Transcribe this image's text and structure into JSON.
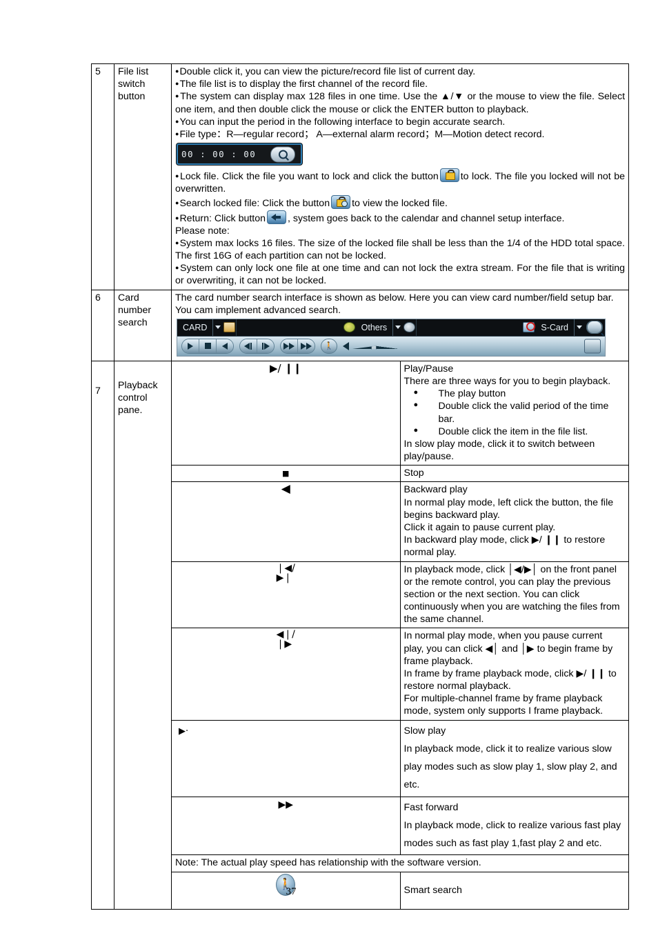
{
  "page": {
    "number": "37"
  },
  "table": {
    "rows": [
      {
        "num": "5",
        "name": "File list switch button",
        "bullets": [
          "Double click it, you can view the picture/record file list of current day.",
          "The file list is to display the first channel of the record file.",
          "The system can display max 128 files in one time. Use the ▲/▼ or the mouse to view the file. Select one item, and then double click the mouse or click the ENTER button to playback.",
          "You can input the period in the following interface to begin accurate search.",
          "File type：R—regular record；  A—external alarm record；M—Motion detect record."
        ],
        "time_widget": {
          "value": "00 : 00 : 00",
          "search_icon": "magnifier-icon"
        },
        "bullets2_a": "Lock file. Click the file you want to lock and click the button",
        "bullets2_a_tail": "to lock. The file you locked will not be overwritten.",
        "bullets2_b": "Search locked file: Click the button",
        "bullets2_b_tail": "to view the locked file.",
        "bullets2_c": "Return: Click button",
        "bullets2_c_tail": ", system goes back to the calendar and channel setup interface.",
        "please_note": "Please note:",
        "bullets3": [
          "System max locks 16 files. The size of the locked file shall be less than the 1/4 of the HDD total space. The first 16G of each partition can not be locked.",
          "System can only lock one file at one time and can not lock the extra stream. For the file that is writing or overwriting, it can not be locked."
        ]
      },
      {
        "num": "6",
        "name": "Card number search",
        "intro": "The card number search interface is shown as below. Here you can view card number/field setup bar. You cam implement advanced search.",
        "card_bar": {
          "field1_label": "CARD",
          "field1_icon": "card-icon",
          "field2_label": "Others",
          "field2_icon": "money-icon",
          "field3_icon": "coin-icon",
          "field4_icon": "scard-blocked-icon",
          "field4_label": "S-Card",
          "search_icon": "magnifier-icon"
        },
        "playbar": {
          "buttons": [
            "play-button",
            "stop-button",
            "backward-play-button",
            "prev-frame-button",
            "next-frame-button",
            "prev-section-button",
            "fast-forward-button",
            "smart-search-button"
          ],
          "volume_icon": "speaker-icon",
          "grid_icon": "grid-button"
        }
      },
      {
        "num": "7",
        "name": "Playback control pane.",
        "items": [
          {
            "icon_type": "play-pause",
            "icon_glyph": "▶/ ❙❙",
            "lines": [
              "Play/Pause",
              "There are three ways for you to begin playback."
            ],
            "dots": [
              "The play button",
              "Double click the valid period of the time bar.",
              "Double click the item in the file list."
            ],
            "tail": "In slow play mode, click it to switch between play/pause."
          },
          {
            "icon_type": "stop",
            "icon_glyph": "■",
            "lines": [
              "Stop"
            ],
            "dots": [],
            "tail": ""
          },
          {
            "icon_type": "backward",
            "icon_glyph": "◀",
            "lines": [
              "Backward play",
              "In normal play mode, left click the button, the file begins backward play.",
              "Click it again to pause current play.",
              "In backward play mode, click ▶/ ❙❙ to restore normal play."
            ],
            "dots": [],
            "tail": ""
          },
          {
            "icon_type": "prev-next-section",
            "icon_glyph_top": "❘◀/",
            "icon_glyph_bottom": "▶❘",
            "lines": [
              "In playback mode, click │◀/▶│ on the front panel or the remote control, you can play the previous section or the next section. You can click continuously when you are watching the files from the same channel."
            ],
            "dots": [],
            "tail": ""
          },
          {
            "icon_type": "frame-by-frame",
            "icon_glyph_top": "◀❘/",
            "icon_glyph_bottom": "❘▶",
            "lines": [
              "In normal play mode, when you pause current play, you can click ◀│ and │▶ to begin frame by frame playback.",
              "In frame by frame playback mode, click ▶/ ❙❙ to restore normal playback.",
              "For multiple-channel frame by frame playback mode, system only supports I frame playback."
            ],
            "dots": [],
            "tail": ""
          },
          {
            "icon_type": "slow-play",
            "icon_glyph": "▶·",
            "lines": [
              "Slow play",
              "In playback mode, click it to realize various slow play modes such as slow play 1, slow play 2, and etc."
            ],
            "dots": [],
            "tail": ""
          },
          {
            "icon_type": "fast-forward",
            "icon_glyph": "▶▶",
            "lines": [
              "Fast forward",
              "In playback mode, click to realize various fast play modes such as  fast play 1,fast play 2 and etc."
            ],
            "dots": [],
            "tail": ""
          }
        ],
        "note": "Note: The actual play speed has relationship with the software version.",
        "smart_search": {
          "icon": "walking-person-icon",
          "label": "Smart search"
        }
      }
    ]
  }
}
